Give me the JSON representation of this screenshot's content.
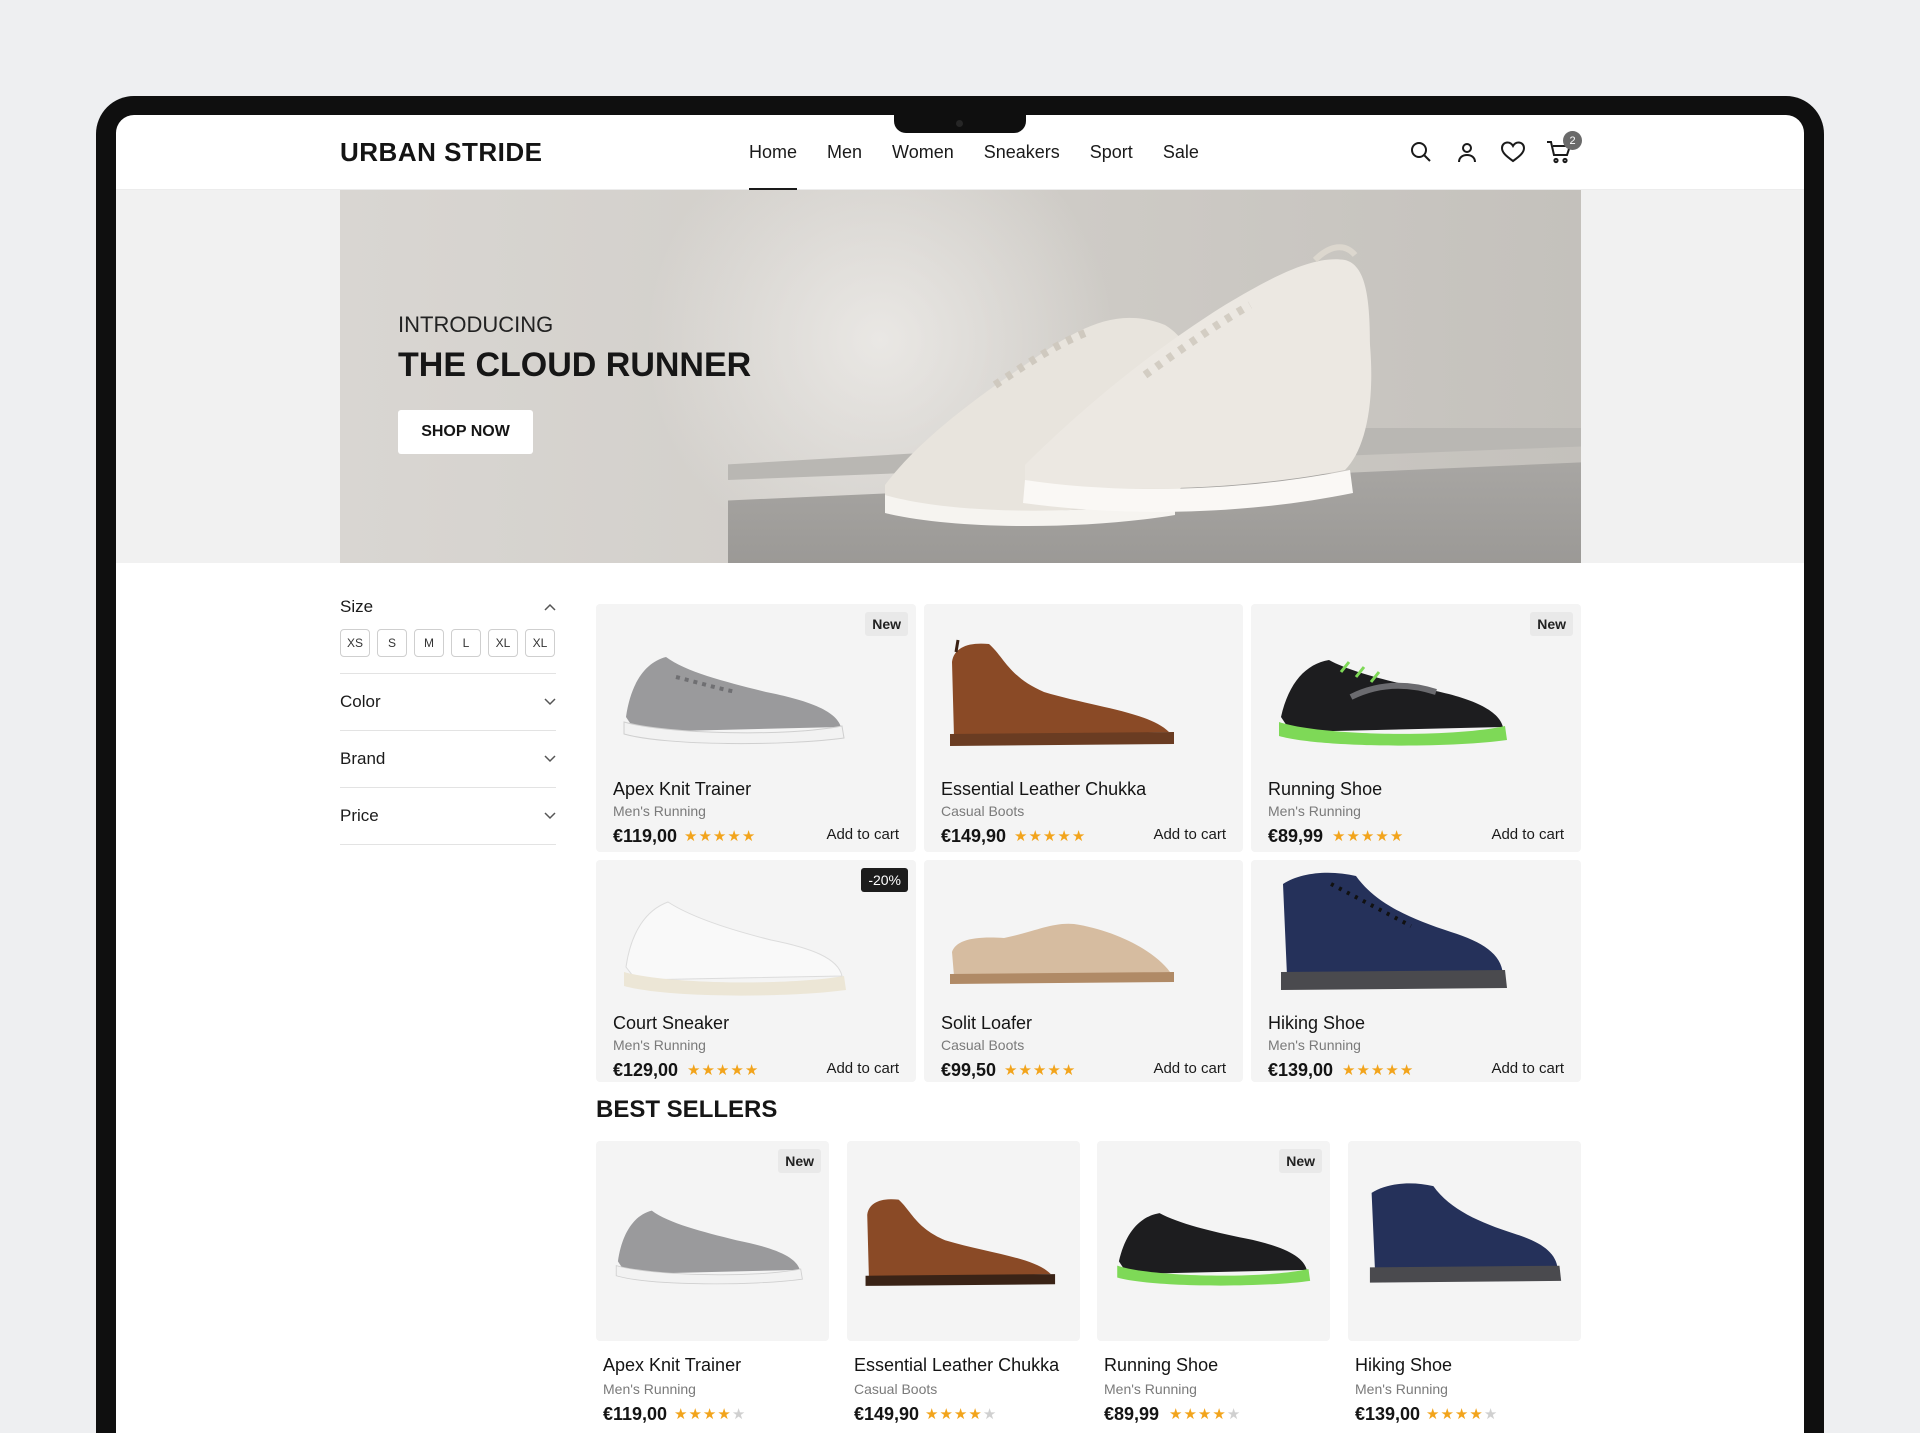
{
  "header": {
    "logo": "URBAN STRIDE",
    "nav": [
      "Home",
      "Men",
      "Women",
      "Sneakers",
      "Sport",
      "Sale"
    ],
    "active_nav": "Home",
    "cart_count": "2"
  },
  "hero": {
    "eyebrow": "INTRODUCING",
    "title": "THE CLOUD RUNNER",
    "cta": "SHOP NOW"
  },
  "filters": {
    "size_label": "Size",
    "sizes": [
      "XS",
      "S",
      "M",
      "L",
      "XL",
      "XL"
    ],
    "collapsed": [
      "Color",
      "Brand",
      "Price"
    ]
  },
  "products": [
    {
      "name": "Apex Knit Trainer",
      "category": "Men's Running",
      "price": "€119,00",
      "rating": 5,
      "badge": "New",
      "action": "Add to cart"
    },
    {
      "name": "Essential Leather Chukka",
      "category": "Casual Boots",
      "price": "€149,90",
      "rating": 5,
      "badge": "",
      "action": "Add to cart"
    },
    {
      "name": "Running Shoe",
      "category": "Men's Running",
      "price": "€89,99",
      "rating": 5,
      "badge": "New",
      "action": "Add to cart"
    },
    {
      "name": "Court Sneaker",
      "category": "Men's Running",
      "price": "€129,00",
      "rating": 5,
      "badge": "-20%",
      "action": "Add to cart"
    },
    {
      "name": "Solit Loafer",
      "category": "Casual Boots",
      "price": "€99,50",
      "rating": 4.5,
      "badge": "",
      "action": "Add to cart"
    },
    {
      "name": "Hiking Shoe",
      "category": "Men's Running",
      "price": "€139,00",
      "rating": 4.5,
      "badge": "",
      "action": "Add to cart"
    }
  ],
  "best_sellers": {
    "title": "BEST SELLERS",
    "items": [
      {
        "name": "Apex Knit Trainer",
        "category": "Men's Running",
        "price": "€119,00",
        "rating": 4,
        "badge": "New"
      },
      {
        "name": "Essential Leather Chukka",
        "category": "Casual Boots",
        "price": "€149,90",
        "rating": 4,
        "badge": ""
      },
      {
        "name": "Running Shoe",
        "category": "Men's Running",
        "price": "€89,99",
        "rating": 4,
        "badge": "New"
      },
      {
        "name": "Hiking Shoe",
        "category": "Men's Running",
        "price": "€139,00",
        "rating": 4,
        "badge": ""
      }
    ]
  },
  "colors": {
    "star": "#f2a41c",
    "accent_green": "#7ed957",
    "navy": "#25315a",
    "leather": "#8a4a26"
  }
}
